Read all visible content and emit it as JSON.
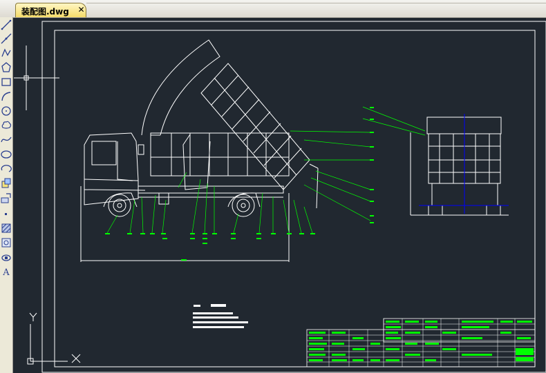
{
  "document_tab": {
    "title": "装配图.dwg",
    "close_glyph": "✕"
  },
  "toolbar": {
    "tools": [
      {
        "name": "line-icon"
      },
      {
        "name": "construction-line-icon"
      },
      {
        "name": "polyline-icon"
      },
      {
        "name": "polygon-icon"
      },
      {
        "name": "rectangle-icon"
      },
      {
        "name": "arc-icon"
      },
      {
        "name": "circle-icon"
      },
      {
        "name": "revision-cloud-icon"
      },
      {
        "name": "spline-icon"
      },
      {
        "name": "ellipse-icon"
      },
      {
        "name": "ellipse-arc-icon"
      },
      {
        "name": "insert-block-icon"
      },
      {
        "name": "make-block-icon"
      },
      {
        "name": "point-icon"
      },
      {
        "name": "hatch-icon"
      },
      {
        "name": "region-icon"
      },
      {
        "name": "table-icon"
      },
      {
        "name": "multiline-text-icon",
        "label": "A"
      }
    ]
  },
  "canvas": {
    "background_color": "#212830",
    "ucs_icon": {
      "x_label": "X",
      "y_label": "Y"
    },
    "colors": {
      "geometry": "#ffffff",
      "annotation": "#00ff00",
      "centerline": "#0000ff"
    }
  }
}
